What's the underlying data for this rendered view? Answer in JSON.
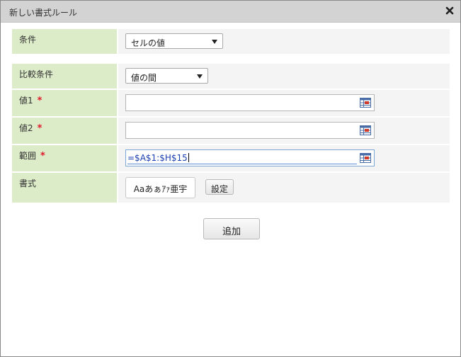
{
  "dialog": {
    "title": "新しい書式ルール",
    "close_icon": "close-x-icon"
  },
  "condition": {
    "label": "条件",
    "selected": "セルの値"
  },
  "comparison": {
    "label": "比較条件",
    "selected": "値の間"
  },
  "value1": {
    "label": "値1",
    "required_mark": "*",
    "value": ""
  },
  "value2": {
    "label": "値2",
    "required_mark": "*",
    "value": ""
  },
  "range": {
    "label": "範囲",
    "required_mark": "*",
    "value": "=$A$1:$H$15"
  },
  "format": {
    "label": "書式",
    "preview_label": "Aaあぁｱｧ亜宇",
    "settings_label": "設定"
  },
  "add_button_label": "追加",
  "colors": {
    "label_bg": "#dcebc8",
    "value_bg": "#f4f4f4",
    "required": "#e0192a",
    "range_text": "#1a3fb0"
  }
}
